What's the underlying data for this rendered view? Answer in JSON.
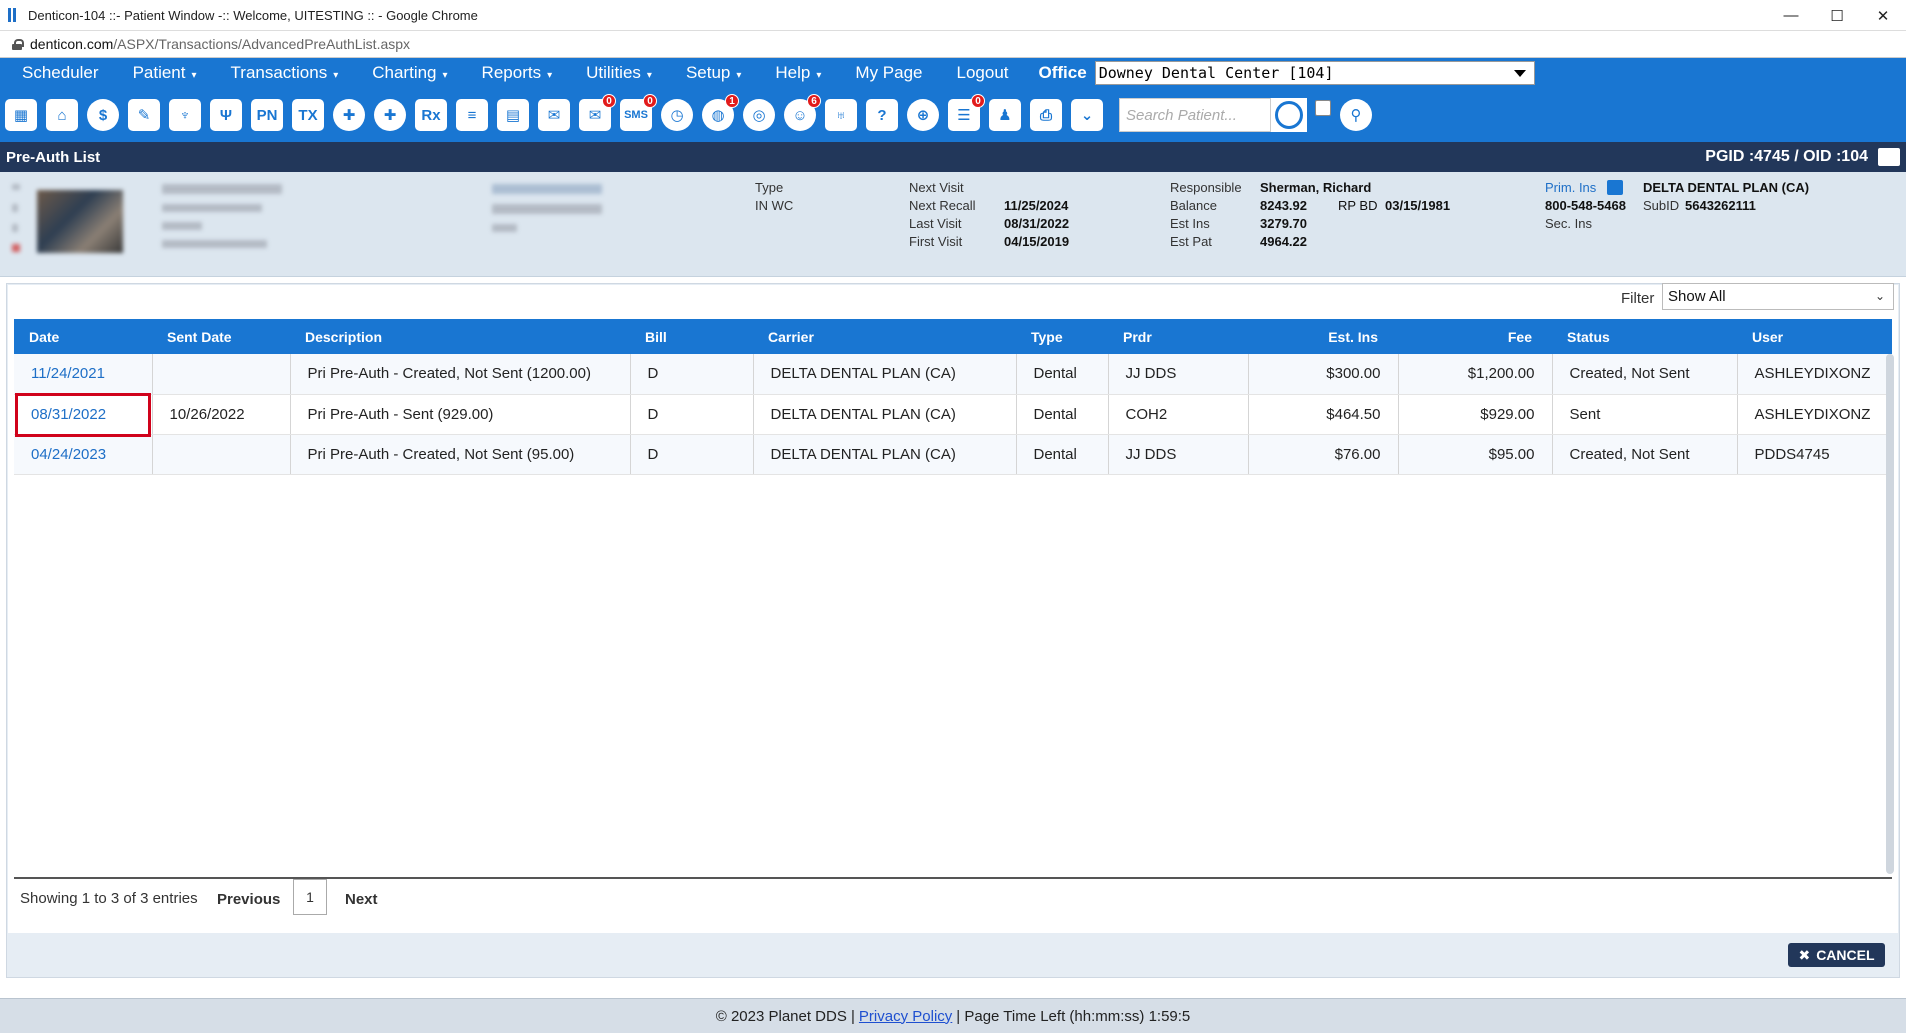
{
  "window": {
    "title": "Denticon-104 ::- Patient Window -:: Welcome, UITESTING :: - Google Chrome",
    "controls": [
      "—",
      "☐",
      "✕"
    ]
  },
  "url": {
    "host": "denticon.com",
    "path": "/ASPX/Transactions/AdvancedPreAuthList.aspx"
  },
  "menu": {
    "items": [
      {
        "label": "Scheduler",
        "caret": ""
      },
      {
        "label": "Patient",
        "caret": "▾"
      },
      {
        "label": "Transactions",
        "caret": "▾"
      },
      {
        "label": "Charting",
        "caret": "▾"
      },
      {
        "label": "Reports",
        "caret": "▾"
      },
      {
        "label": "Utilities",
        "caret": "▾"
      },
      {
        "label": "Setup",
        "caret": "▾"
      },
      {
        "label": "Help",
        "caret": "▾"
      },
      {
        "label": "My Page",
        "caret": ""
      },
      {
        "label": "Logout",
        "caret": ""
      }
    ],
    "office_label": "Office",
    "office_value": "Downey Dental Center [104]"
  },
  "toolbar": {
    "search_placeholder": "Search Patient...",
    "badges": {
      "messages": "0",
      "sms": "0",
      "web": "1",
      "alerts": "6",
      "forms": "0"
    },
    "icons": {
      "pn": "PN",
      "tx": "TX",
      "rx": "Rx",
      "sms": "SMS"
    }
  },
  "titleband": {
    "left": "Pre-Auth List",
    "right": "PGID :4745  /  OID :104"
  },
  "patient": {
    "type_label": "Type",
    "type_value": "IN WC",
    "next_visit_label": "Next Visit",
    "next_recall_label": "Next Recall",
    "next_recall_value": "11/25/2024",
    "last_visit_label": "Last Visit",
    "last_visit_value": "08/31/2022",
    "first_visit_label": "First Visit",
    "first_visit_value": "04/15/2019",
    "responsible_label": "Responsible",
    "responsible_value": "Sherman, Richard",
    "balance_label": "Balance",
    "balance_value": "8243.92",
    "rpbd_label": "RP BD",
    "rpbd_value": "03/15/1981",
    "est_ins_label": "Est Ins",
    "est_ins_value": "3279.70",
    "est_pat_label": "Est Pat",
    "est_pat_value": "4964.22",
    "prim_ins_label": "Prim. Ins",
    "prim_ins_value": "DELTA DENTAL PLAN (CA)",
    "ins_phone": "800-548-5468",
    "subid_label": "SubID",
    "subid_value": "5643262111",
    "sec_ins_label": "Sec. Ins"
  },
  "filter": {
    "label": "Filter",
    "value": "Show All",
    "chevron": "⌄"
  },
  "table": {
    "headers": [
      "Date",
      "Sent Date",
      "Description",
      "Bill",
      "Carrier",
      "Type",
      "Prdr",
      "Est. Ins",
      "Fee",
      "Status",
      "User"
    ],
    "rows": [
      {
        "date": "11/24/2021",
        "sent": "",
        "desc": "Pri Pre-Auth - Created, Not Sent (1200.00)",
        "bill": "D",
        "carrier": "DELTA DENTAL PLAN (CA)",
        "type": "Dental",
        "prdr": "JJ DDS",
        "est_ins": "$300.00",
        "fee": "$1,200.00",
        "status": "Created, Not Sent",
        "user": "ASHLEYDIXONZ"
      },
      {
        "date": "08/31/2022",
        "sent": "10/26/2022",
        "desc": "Pri Pre-Auth - Sent (929.00)",
        "bill": "D",
        "carrier": "DELTA DENTAL PLAN (CA)",
        "type": "Dental",
        "prdr": "COH2",
        "est_ins": "$464.50",
        "fee": "$929.00",
        "status": "Sent",
        "user": "ASHLEYDIXONZ"
      },
      {
        "date": "04/24/2023",
        "sent": "",
        "desc": "Pri Pre-Auth - Created, Not Sent (95.00)",
        "bill": "D",
        "carrier": "DELTA DENTAL PLAN (CA)",
        "type": "Dental",
        "prdr": "JJ DDS",
        "est_ins": "$76.00",
        "fee": "$95.00",
        "status": "Created, Not Sent",
        "user": "PDDS4745"
      }
    ]
  },
  "pagination": {
    "showing": "Showing 1 to 3 of 3 entries",
    "previous": "Previous",
    "page": "1",
    "next": "Next"
  },
  "cancel": {
    "icon": "✖",
    "label": "CANCEL"
  },
  "footer": {
    "copyright": "© 2023 Planet DDS |",
    "privacy": "Privacy Policy",
    "page_time": "|  Page Time Left (hh:mm:ss) 1:59:5"
  },
  "colors": {
    "primary": "#1976d2",
    "dark_navy": "#22375a",
    "highlight": "#d0021b",
    "link": "#1e6fc7"
  }
}
